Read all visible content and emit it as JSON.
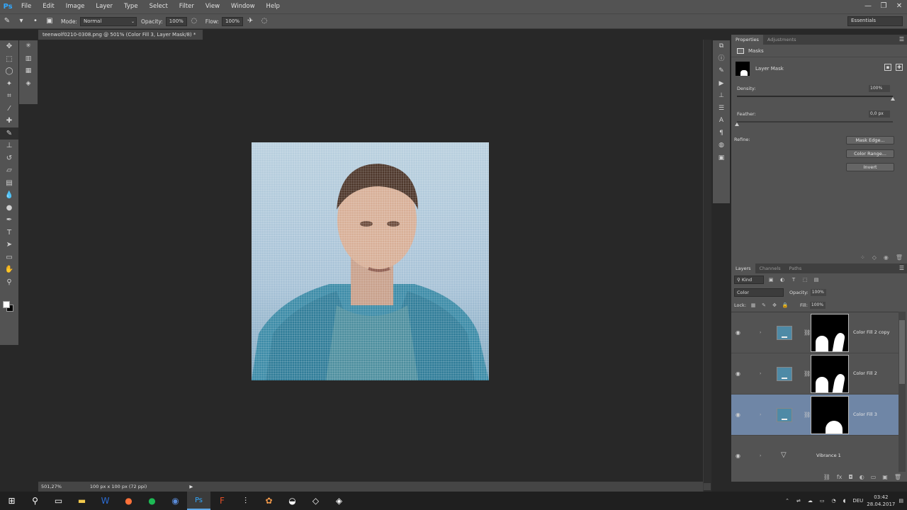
{
  "app": {
    "logo": "Ps"
  },
  "menu": [
    "File",
    "Edit",
    "Image",
    "Layer",
    "Type",
    "Select",
    "Filter",
    "View",
    "Window",
    "Help"
  ],
  "window_controls": {
    "minimize": "—",
    "restore": "❐",
    "close": "✕"
  },
  "options_bar": {
    "mode_label": "Mode:",
    "mode_value": "Normal",
    "opacity_label": "Opacity:",
    "opacity_value": "100%",
    "flow_label": "Flow:",
    "flow_value": "100%",
    "workspace": "Essentials"
  },
  "document": {
    "tab_title": "teenwolf0210-0308.png @ 501% (Color Fill 3, Layer Mask/8) *",
    "zoom": "501,27%",
    "doc_info": "100 px x 100 px (72 ppi)"
  },
  "properties": {
    "tabs": [
      "Properties",
      "Adjustments"
    ],
    "section": "Masks",
    "mask_type": "Layer Mask",
    "density_label": "Density:",
    "density_value": "100%",
    "density_fraction": 1.0,
    "feather_label": "Feather:",
    "feather_value": "0,0 px",
    "feather_fraction": 0.0,
    "refine_label": "Refine:",
    "buttons": [
      "Mask Edge...",
      "Color Range...",
      "Invert"
    ]
  },
  "layers_panel": {
    "tabs": [
      "Layers",
      "Channels",
      "Paths"
    ],
    "kind_label": "Kind",
    "blend_mode": "Color",
    "opacity_label": "Opacity:",
    "opacity_value": "100%",
    "lock_label": "Lock:",
    "fill_label": "Fill:",
    "fill_value": "100%",
    "layers": [
      {
        "name": "Color Fill 2 copy",
        "selected": false
      },
      {
        "name": "Color Fill 2",
        "selected": false
      },
      {
        "name": "Color Fill 3",
        "selected": true
      },
      {
        "name": "Vibrance 1",
        "selected": false
      }
    ]
  },
  "taskbar": {
    "language": "DEU",
    "time": "03:42",
    "date": "28.04.2017"
  },
  "colors": {
    "accent": "#31a8ff",
    "panel_bg": "#535353",
    "canvas_bg": "#282828",
    "selected_layer": "#6f86a6",
    "fill_color": "#4e8aa6"
  }
}
